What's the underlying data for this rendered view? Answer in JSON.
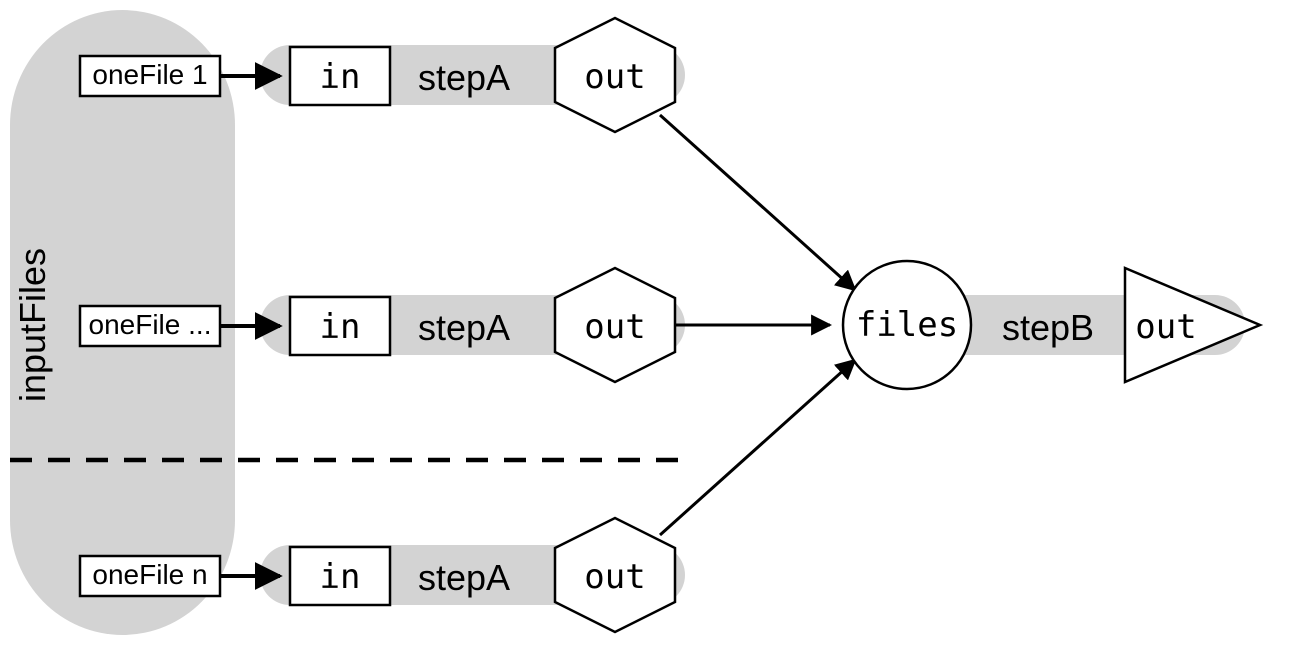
{
  "inputFilesLabel": "inputFiles",
  "rows": [
    {
      "onefile": "oneFile 1",
      "in": "in",
      "step": "stepA",
      "out": "out"
    },
    {
      "onefile": "oneFile ...",
      "in": "in",
      "step": "stepA",
      "out": "out"
    },
    {
      "onefile": "oneFile n",
      "in": "in",
      "step": "stepA",
      "out": "out"
    }
  ],
  "files": "files",
  "stepB": "stepB",
  "finalOut": "out"
}
